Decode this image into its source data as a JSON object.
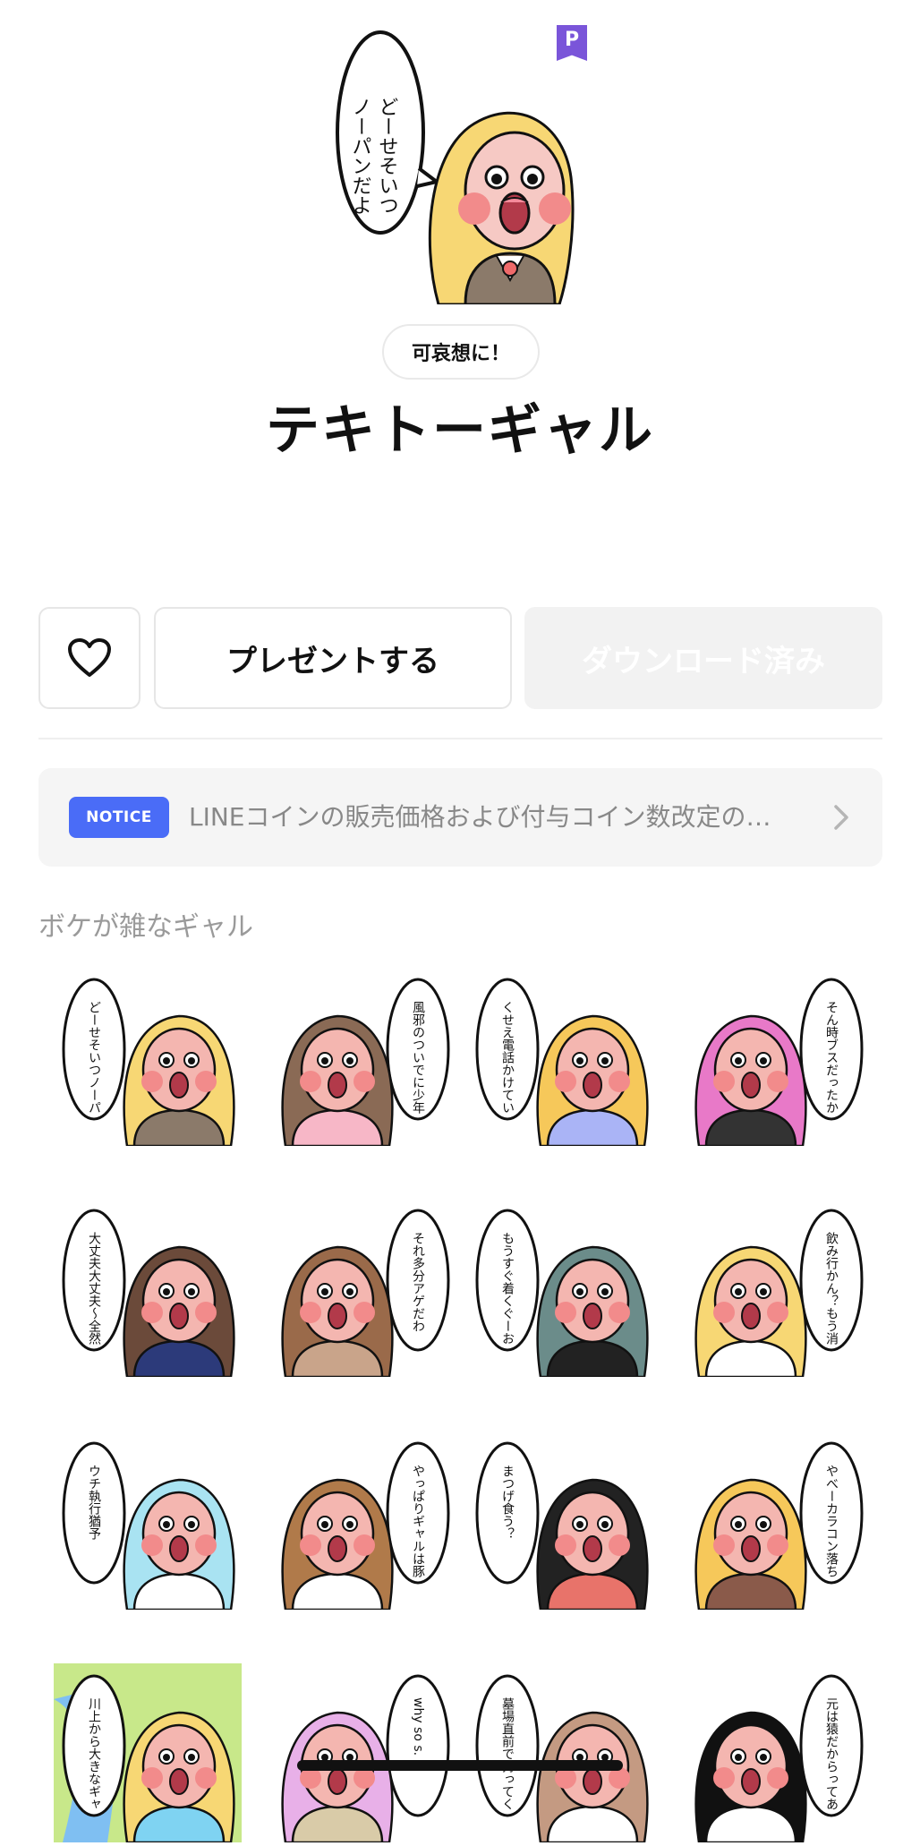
{
  "product": {
    "badge_letter": "P",
    "tag": "可哀想に！",
    "title": "テキトーギャル"
  },
  "actions": {
    "present_label": "プレゼントする",
    "download_label": "ダウンロード済み"
  },
  "notice": {
    "badge": "NOTICE",
    "text": "LINEコインの販売価格および付与コイン数改定の…"
  },
  "section": {
    "title": "ボケが雑なギャル"
  },
  "colors": {
    "accent_purple": "#7a55d9",
    "notice_blue": "#4a6cf7",
    "skin": "#f4b6b0",
    "cheek": "#f28b8b"
  },
  "stickers": [
    {
      "hair": "#f7d774",
      "shirt": "#8b7a6a",
      "bubble": "どーせそいつノーパンだよ"
    },
    {
      "hair": "#8a6a55",
      "shirt": "#f7b7c7",
      "bubble": "風邪のついでに少年院入るわ"
    },
    {
      "hair": "#f6c85a",
      "shirt": "#aab4f6",
      "bubble": "くせえ電話かけていい？"
    },
    {
      "hair": "#e879c8",
      "shirt": "#333333",
      "bubble": "そん時ブスだったから覚えてねーわ"
    },
    {
      "hair": "#6b4a3a",
      "shirt": "#2c3a7a",
      "bubble": "大丈夫大丈夫〜全然気にしてー"
    },
    {
      "hair": "#9a6a4a",
      "shirt": "#c9a48a",
      "bubble": "それ多分アゲだわ"
    },
    {
      "hair": "#6b8c8a",
      "shirt": "#222222",
      "bubble": "もうすぐ着くぐーお前が"
    },
    {
      "hair": "#f7d774",
      "shirt": "#ffffff",
      "bubble": "飲み行かん？もう消毒液でもイイんだが"
    },
    {
      "hair": "#a9e3f2",
      "shirt": "#ffffff",
      "bubble": "ウチ執行猶予"
    },
    {
      "hair": "#b07a4a",
      "shirt": "#ffffff",
      "bubble": "やっぱりギャルは豚舎っしょ"
    },
    {
      "hair": "#222222",
      "shirt": "#e8736a",
      "bubble": "まつげ食う？"
    },
    {
      "hair": "#f6c85a",
      "shirt": "#8a5a4a",
      "bubble": "やべーカラコン落ちたあと受験"
    },
    {
      "hair": "#f7d774",
      "shirt": "#7fd3f2",
      "bubble": "川上から大きなギャルが!!"
    },
    {
      "hair": "#e8b0e8",
      "shirt": "#d9cba8",
      "bubble": "why so s..."
    },
    {
      "hair": "#c49a82",
      "shirt": "#ffffff",
      "bubble": "墓場直前で持ってくわ"
    },
    {
      "hair": "#111111",
      "shirt": "#ffffff",
      "bubble": "元は猿だからってあんまりナメんなよ"
    }
  ]
}
